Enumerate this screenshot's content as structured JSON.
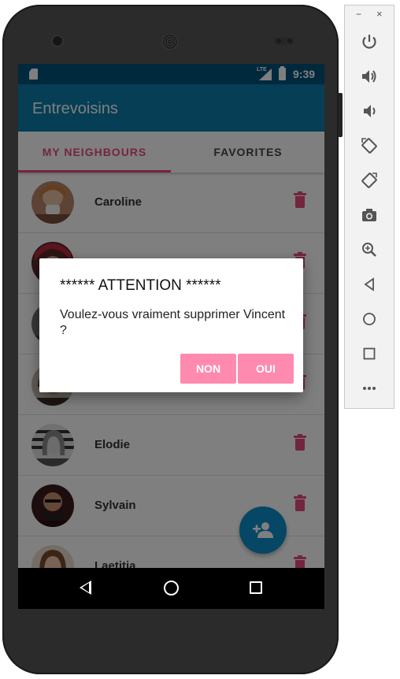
{
  "colors": {
    "primary": "#0a7cab",
    "primary_dark": "#00527a",
    "accent": "#e84a7a",
    "fab": "#0b8fc9",
    "dialog_button": "#ff8ab0"
  },
  "status_bar": {
    "network": "LTE",
    "time": "9:39"
  },
  "app": {
    "title": "Entrevoisins"
  },
  "tabs": [
    {
      "label": "MY NEIGHBOURS",
      "selected": true
    },
    {
      "label": "FAVORITES",
      "selected": false
    }
  ],
  "neighbours": [
    {
      "name": "Caroline"
    },
    {
      "name": ""
    },
    {
      "name": ""
    },
    {
      "name": ""
    },
    {
      "name": "Elodie"
    },
    {
      "name": "Sylvain"
    },
    {
      "name": "Laetitia"
    }
  ],
  "dialog": {
    "title": "****** ATTENTION ******",
    "message": "Voulez-vous vraiment supprimer Vincent ?",
    "negative": "NON",
    "positive": "OUI"
  },
  "fab": {
    "icon": "add-person-icon"
  },
  "nav": {
    "back_icon": "back-icon",
    "home_icon": "home-icon",
    "recents_icon": "recents-icon"
  },
  "emulator_panel": {
    "window": {
      "minimize": "−",
      "close": "×"
    },
    "buttons": [
      "power-icon",
      "volume-up-icon",
      "volume-down-icon",
      "rotate-left-icon",
      "rotate-right-icon",
      "camera-icon",
      "zoom-icon",
      "back-icon",
      "home-icon",
      "overview-icon",
      "more-icon"
    ]
  }
}
